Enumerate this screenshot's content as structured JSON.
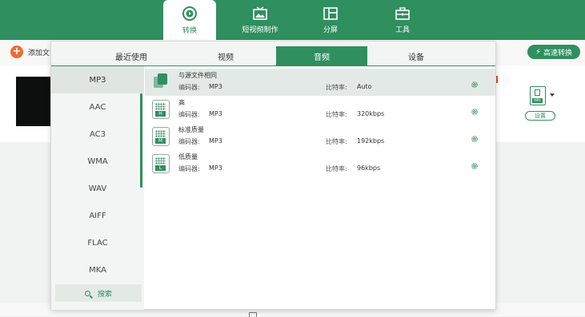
{
  "nav": {
    "items": [
      {
        "label": "转换",
        "icon": "convert-icon",
        "active": true
      },
      {
        "label": "短视频制作",
        "icon": "tv-icon",
        "active": false
      },
      {
        "label": "分屏",
        "icon": "split-screen-icon",
        "active": false
      },
      {
        "label": "工具",
        "icon": "toolbox-icon",
        "active": false
      }
    ]
  },
  "toolbar": {
    "add_label": "添加文",
    "speed_label": "高速转换"
  },
  "file": {
    "format_badge": "MP4",
    "settings_label": "设置"
  },
  "dropdown": {
    "tabs": [
      "最近使用",
      "视频",
      "音频",
      "设备"
    ],
    "active_tab": "音频",
    "formats": [
      "MP3",
      "AAC",
      "AC3",
      "WMA",
      "WAV",
      "AIFF",
      "FLAC",
      "MKA"
    ],
    "active_format": "MP3",
    "search_label": "搜索",
    "presets": [
      {
        "name": "与源文件相同",
        "encoder_label": "编码器:",
        "encoder": "MP3",
        "bitrate_label": "比特率:",
        "bitrate": "Auto",
        "badge": "",
        "icon": "copy-icon"
      },
      {
        "name": "高",
        "encoder_label": "编码器:",
        "encoder": "MP3",
        "bitrate_label": "比特率:",
        "bitrate": "320kbps",
        "badge": "H",
        "icon": "quality-high-icon"
      },
      {
        "name": "标准质量",
        "encoder_label": "编码器:",
        "encoder": "MP3",
        "bitrate_label": "比特率:",
        "bitrate": "192kbps",
        "badge": "M",
        "icon": "quality-medium-icon"
      },
      {
        "name": "低质量",
        "encoder_label": "编码器:",
        "encoder": "MP3",
        "bitrate_label": "比特率:",
        "bitrate": "96kbps",
        "badge": "L",
        "icon": "quality-low-icon"
      }
    ]
  },
  "colors": {
    "brand": "#2f8f5f",
    "accent_orange": "#f06b33"
  }
}
